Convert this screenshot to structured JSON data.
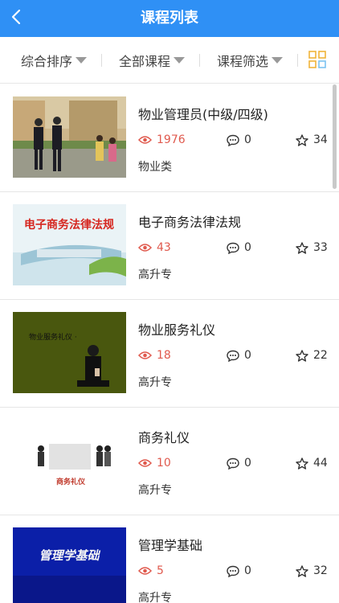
{
  "header": {
    "title": "课程列表"
  },
  "filters": [
    {
      "label": "综合排序"
    },
    {
      "label": "全部课程"
    },
    {
      "label": "课程筛选"
    }
  ],
  "courses": [
    {
      "title": "物业管理员(中级/四级)",
      "views": "1976",
      "comments": "0",
      "stars": "34",
      "category": "物业类",
      "thumb_text": ""
    },
    {
      "title": "电子商务法律法规",
      "views": "43",
      "comments": "0",
      "stars": "33",
      "category": "高升专",
      "thumb_text": "电子商务法律法规"
    },
    {
      "title": "物业服务礼仪",
      "views": "18",
      "comments": "0",
      "stars": "22",
      "category": "高升专",
      "thumb_text": "物业服务礼仪 ·"
    },
    {
      "title": "商务礼仪",
      "views": "10",
      "comments": "0",
      "stars": "44",
      "category": "高升专",
      "thumb_text": "商务礼仪"
    },
    {
      "title": "管理学基础",
      "views": "5",
      "comments": "0",
      "stars": "32",
      "category": "高升专",
      "thumb_text": "管理学基础"
    }
  ],
  "colors": {
    "header": "#2f90f5",
    "views": "#e05a4e"
  },
  "icons": {
    "back": "chevron-left-icon",
    "grid": "grid-icon",
    "eye": "eye-icon",
    "comment": "comment-icon",
    "star": "star-icon"
  }
}
